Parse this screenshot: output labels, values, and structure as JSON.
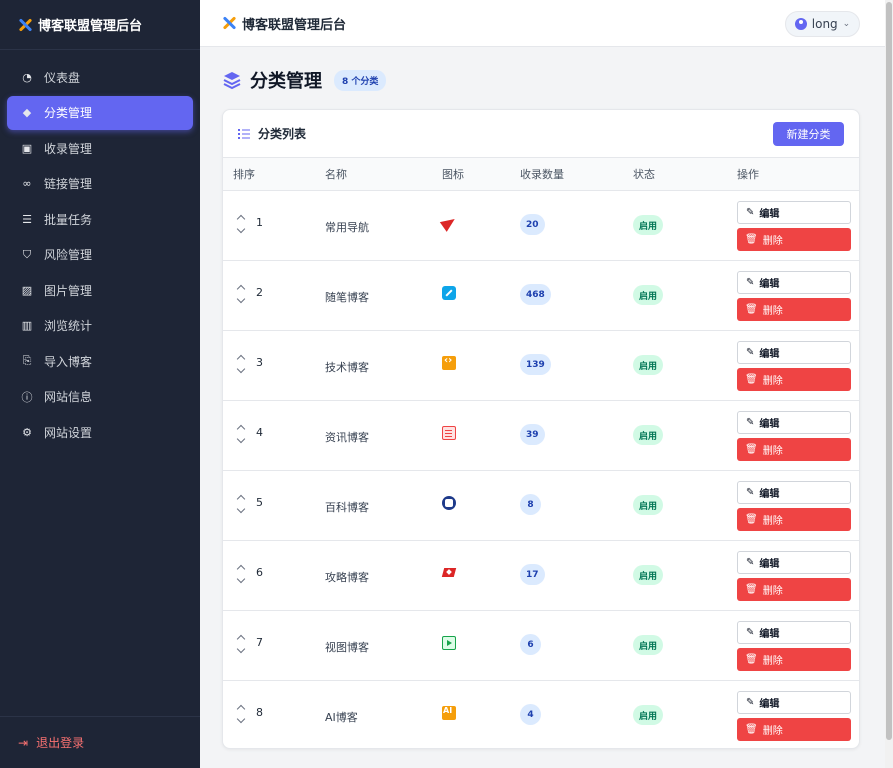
{
  "app": {
    "title": "博客联盟管理后台"
  },
  "sidebar": {
    "brand": "博客联盟管理后台",
    "items": [
      {
        "label": "仪表盘",
        "icon": "gauge-icon",
        "glyph": "◔",
        "active": false
      },
      {
        "label": "分类管理",
        "icon": "layers-icon",
        "glyph": "◆",
        "active": true
      },
      {
        "label": "收录管理",
        "icon": "clipboard-check-icon",
        "glyph": "▣",
        "active": false
      },
      {
        "label": "链接管理",
        "icon": "link-icon",
        "glyph": "∞",
        "active": false
      },
      {
        "label": "批量任务",
        "icon": "list-check-icon",
        "glyph": "☰",
        "active": false
      },
      {
        "label": "风险管理",
        "icon": "shield-icon",
        "glyph": "⛉",
        "active": false
      },
      {
        "label": "图片管理",
        "icon": "image-icon",
        "glyph": "▨",
        "active": false
      },
      {
        "label": "浏览统计",
        "icon": "bar-chart-icon",
        "glyph": "▥",
        "active": false
      },
      {
        "label": "导入博客",
        "icon": "file-import-icon",
        "glyph": "⎘",
        "active": false
      },
      {
        "label": "网站信息",
        "icon": "info-circle-icon",
        "glyph": "ⓘ",
        "active": false
      },
      {
        "label": "网站设置",
        "icon": "gear-icon",
        "glyph": "⚙",
        "active": false
      }
    ],
    "logout": "退出登录"
  },
  "topbar": {
    "title": "博客联盟管理后台",
    "user": "long"
  },
  "page": {
    "title": "分类管理",
    "count_badge": "8 个分类"
  },
  "card": {
    "title": "分类列表",
    "new_button": "新建分类"
  },
  "table": {
    "headers": {
      "sort": "排序",
      "name": "名称",
      "icon": "图标",
      "count": "收录数量",
      "status": "状态",
      "ops": "操作"
    },
    "edit_label": "编辑",
    "delete_label": "删除",
    "rows": [
      {
        "order": "1",
        "name": "常用导航",
        "icon": "paper-plane-icon",
        "count": "20",
        "status": "启用"
      },
      {
        "order": "2",
        "name": "随笔博客",
        "icon": "pen-icon",
        "count": "468",
        "status": "启用"
      },
      {
        "order": "3",
        "name": "技术博客",
        "icon": "code-icon",
        "count": "139",
        "status": "启用"
      },
      {
        "order": "4",
        "name": "资讯博客",
        "icon": "newspaper-icon",
        "count": "39",
        "status": "启用"
      },
      {
        "order": "5",
        "name": "百科博客",
        "icon": "book-icon",
        "count": "8",
        "status": "启用"
      },
      {
        "order": "6",
        "name": "攻略博客",
        "icon": "map-icon",
        "count": "17",
        "status": "启用"
      },
      {
        "order": "7",
        "name": "视图博客",
        "icon": "video-icon",
        "count": "6",
        "status": "启用"
      },
      {
        "order": "8",
        "name": "AI博客",
        "icon": "ai-icon",
        "count": "4",
        "status": "启用"
      }
    ]
  },
  "colors": {
    "sidebar_bg": "#1e2536",
    "accent": "#6366f1",
    "danger": "#ef4444",
    "success_bg": "#d1fae5"
  }
}
